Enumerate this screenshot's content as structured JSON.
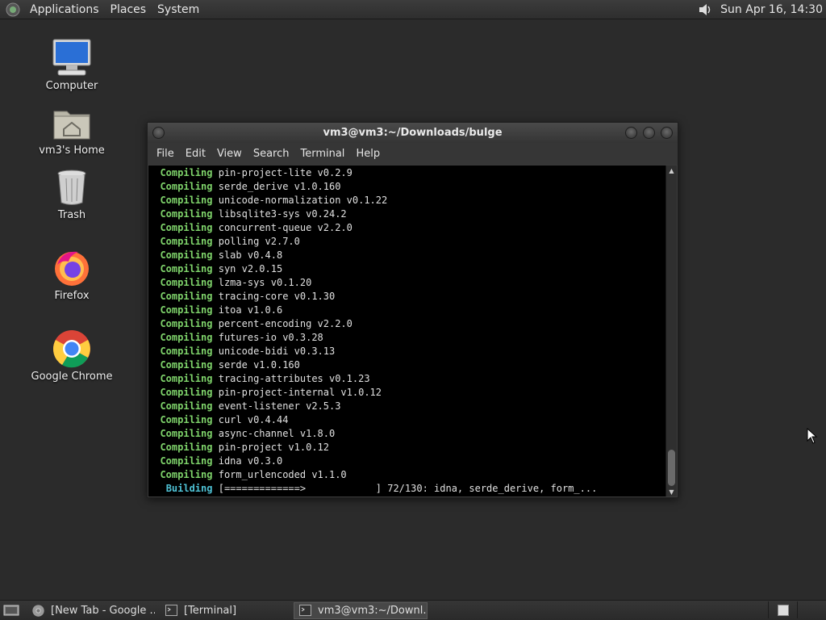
{
  "top_panel": {
    "menus": [
      "Applications",
      "Places",
      "System"
    ],
    "clock": "Sun Apr 16, 14:30"
  },
  "desktop_icons": [
    {
      "label": "Computer",
      "icon": "computer-icon"
    },
    {
      "label": "vm3's Home",
      "icon": "home-folder-icon"
    },
    {
      "label": "Trash",
      "icon": "trash-icon"
    },
    {
      "label": "Firefox",
      "icon": "firefox-icon"
    },
    {
      "label": "Google Chrome",
      "icon": "chrome-icon"
    }
  ],
  "terminal": {
    "title": "vm3@vm3:~/Downloads/bulge",
    "menus": [
      "File",
      "Edit",
      "View",
      "Search",
      "Terminal",
      "Help"
    ],
    "compile_keyword": "Compiling",
    "lines": [
      "pin-project-lite v0.2.9",
      "serde_derive v1.0.160",
      "unicode-normalization v0.1.22",
      "libsqlite3-sys v0.24.2",
      "concurrent-queue v2.2.0",
      "polling v2.7.0",
      "slab v0.4.8",
      "syn v2.0.15",
      "lzma-sys v0.1.20",
      "tracing-core v0.1.30",
      "itoa v1.0.6",
      "percent-encoding v2.2.0",
      "futures-io v0.3.28",
      "unicode-bidi v0.3.13",
      "serde v1.0.160",
      "tracing-attributes v0.1.23",
      "pin-project-internal v1.0.12",
      "event-listener v2.5.3",
      "curl v0.4.44",
      "async-channel v1.8.0",
      "pin-project v1.0.12",
      "idna v0.3.0",
      "form_urlencoded v1.1.0"
    ],
    "building_keyword": "Building",
    "building_status": "[=============>            ] 72/130: idna, serde_derive, form_..."
  },
  "taskbar": {
    "tasks": [
      {
        "label": "[New Tab - Google ...",
        "icon": "chrome-icon",
        "active": false
      },
      {
        "label": "[Terminal]",
        "icon": "terminal-icon",
        "active": false
      },
      {
        "label": "vm3@vm3:~/Downl...",
        "icon": "terminal-icon",
        "active": true
      }
    ]
  },
  "colors": {
    "desktop_bg": "#2b2b2b",
    "compile_keyword": "#7fd46b",
    "building_keyword": "#4fc3d6"
  }
}
